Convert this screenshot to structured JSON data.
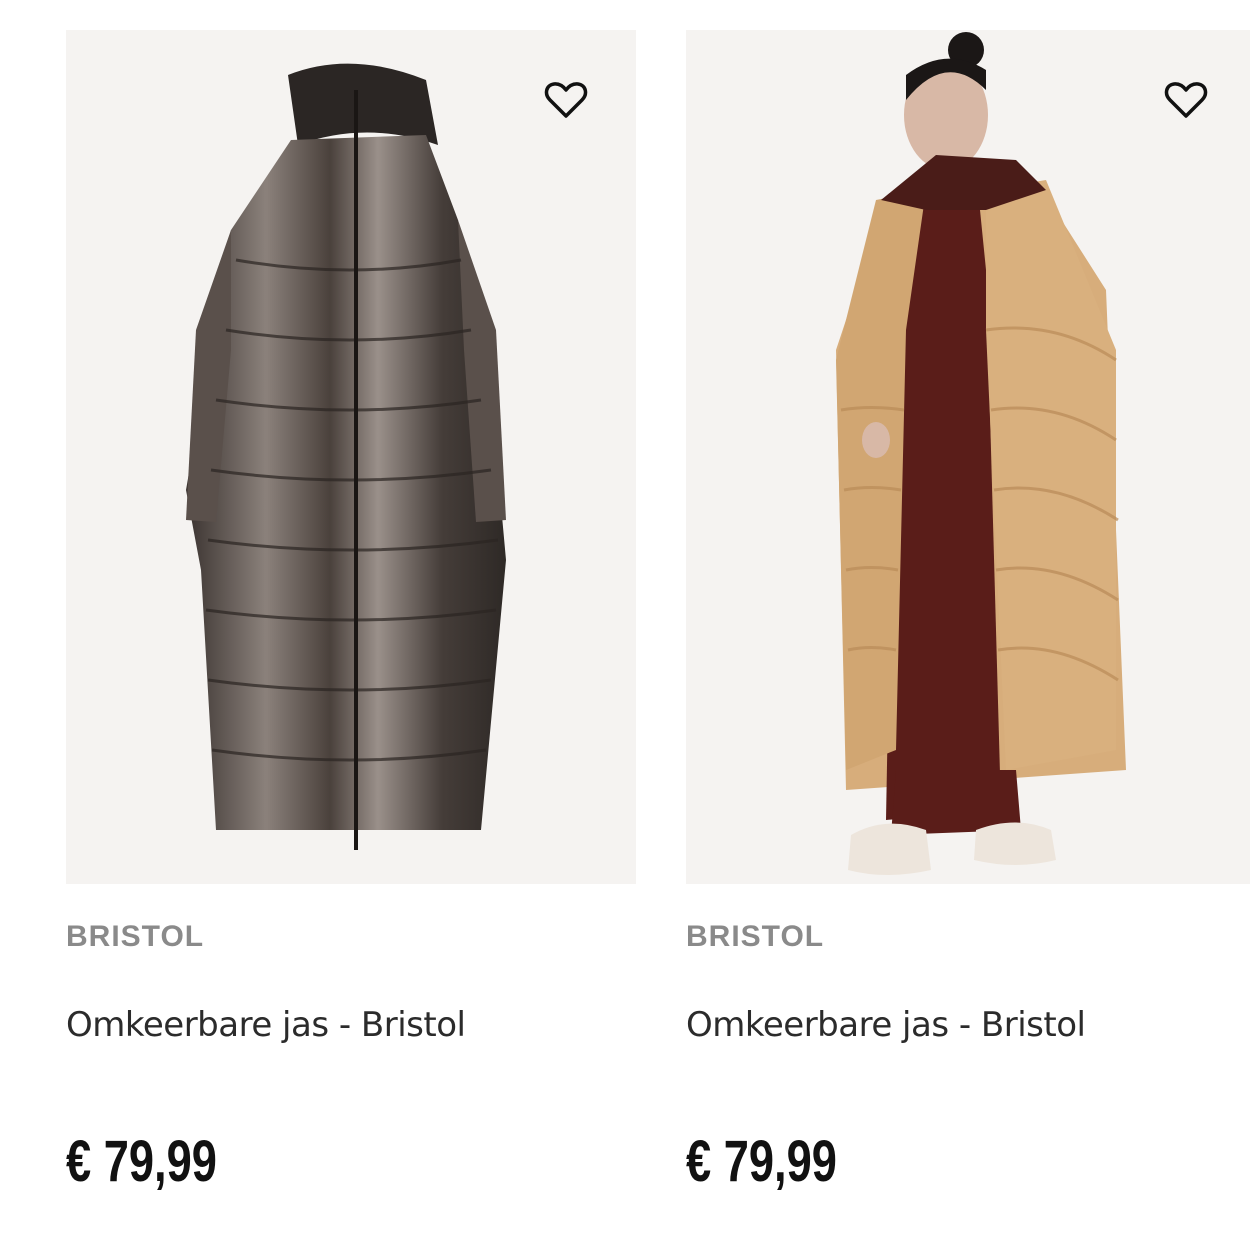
{
  "products": [
    {
      "image_alt": "Metallic long puffer coat",
      "favorite_icon": "heart-outline-icon",
      "brand": "BRISTOL",
      "title": "Omkeerbare jas - Bristol",
      "price": "€ 79,99"
    },
    {
      "image_alt": "Model wearing beige long puffer coat",
      "favorite_icon": "heart-outline-icon",
      "brand": "BRISTOL",
      "title": "Omkeerbare jas - Bristol",
      "price": "€ 79,99"
    }
  ],
  "colors": {
    "image_bg": "#f5f3f1",
    "brand_text": "#8a8a8a",
    "price_text": "#111111"
  }
}
